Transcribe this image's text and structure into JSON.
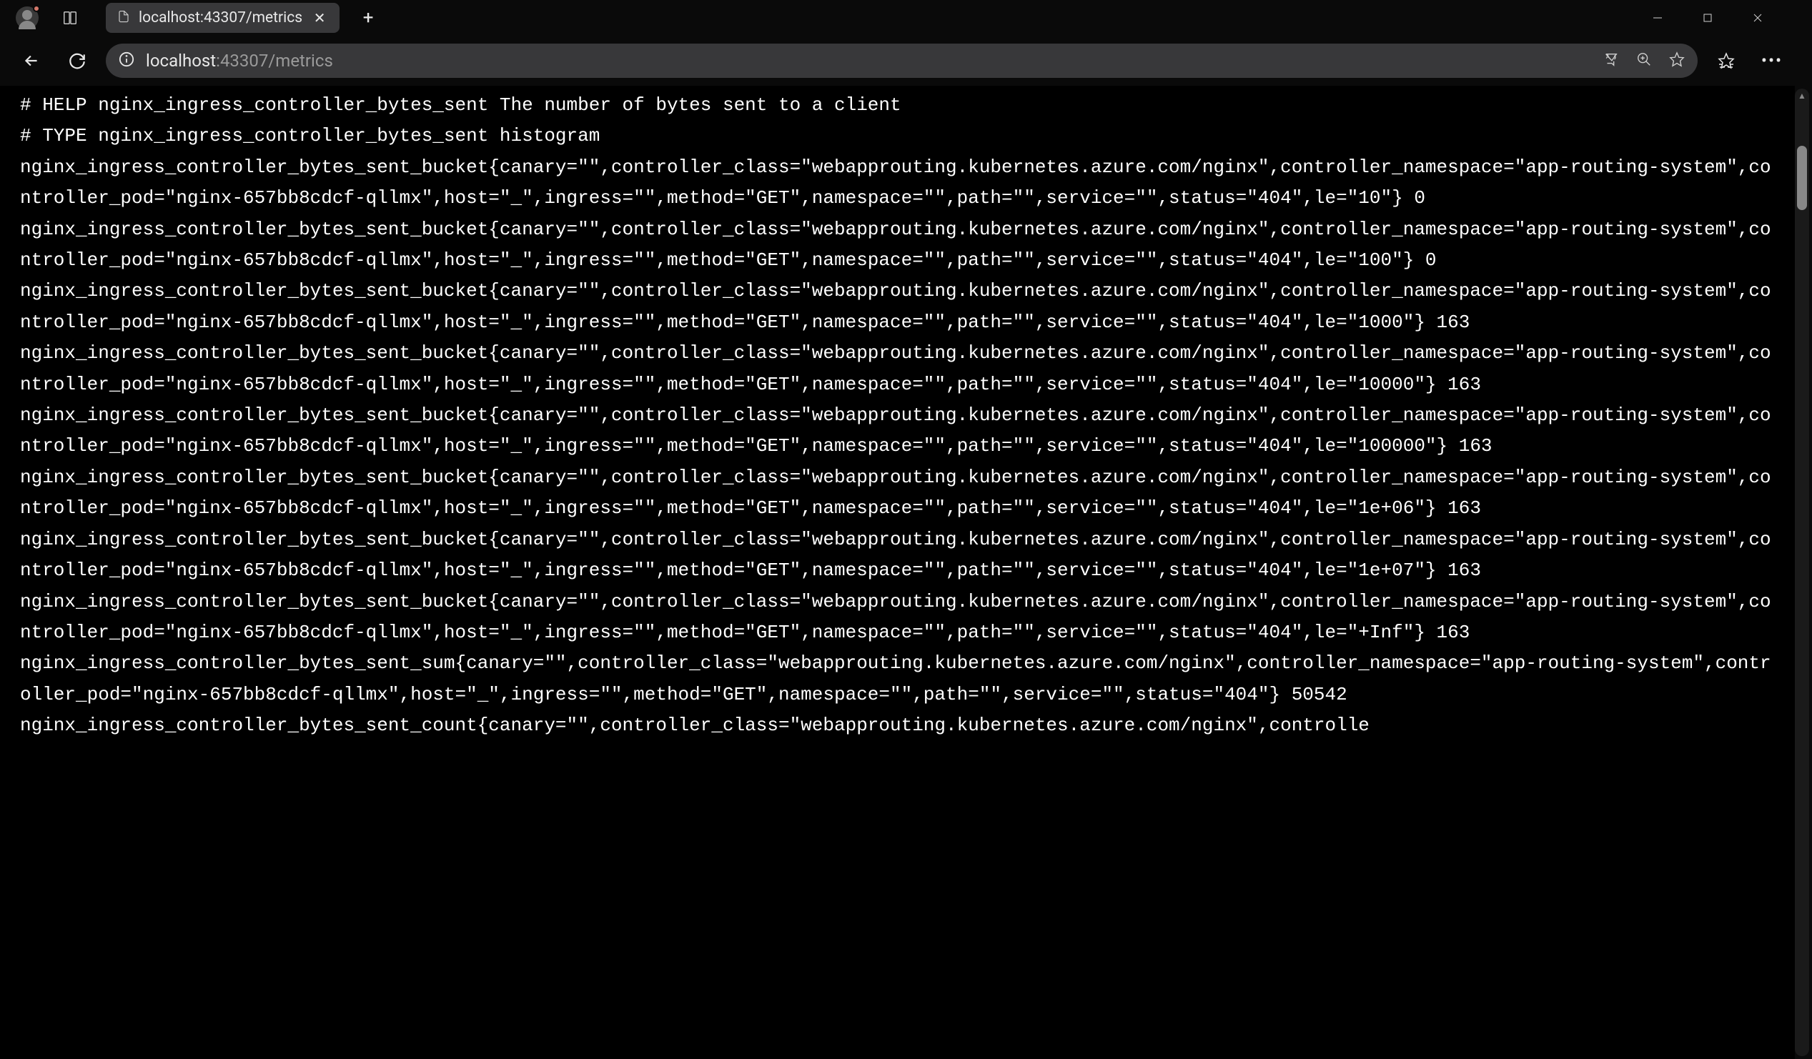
{
  "tab": {
    "title": "localhost:43307/metrics"
  },
  "url": {
    "host": "localhost",
    "path": ":43307/metrics"
  },
  "metrics": {
    "help_line": "# HELP nginx_ingress_controller_bytes_sent The number of bytes sent to a client",
    "type_line": "# TYPE nginx_ingress_controller_bytes_sent histogram",
    "labels": {
      "canary": "",
      "controller_class": "webapprouting.kubernetes.azure.com/nginx",
      "controller_namespace": "app-routing-system",
      "controller_pod": "nginx-657bb8cdcf-qllmx",
      "host": "_",
      "ingress": "",
      "method": "GET",
      "namespace": "",
      "path": "",
      "service": "",
      "status": "404"
    },
    "buckets": [
      {
        "le": "10",
        "value": "0"
      },
      {
        "le": "100",
        "value": "0"
      },
      {
        "le": "1000",
        "value": "163"
      },
      {
        "le": "10000",
        "value": "163"
      },
      {
        "le": "100000",
        "value": "163"
      },
      {
        "le": "1e+06",
        "value": "163"
      },
      {
        "le": "1e+07",
        "value": "163"
      },
      {
        "le": "+Inf",
        "value": "163"
      }
    ],
    "sum": "50542",
    "count_prefix": "nginx_ingress_controller_bytes_sent_count{canary=\"\",controller_class=\"webapprouting.kubernetes.azure.com/nginx\",controlle"
  }
}
